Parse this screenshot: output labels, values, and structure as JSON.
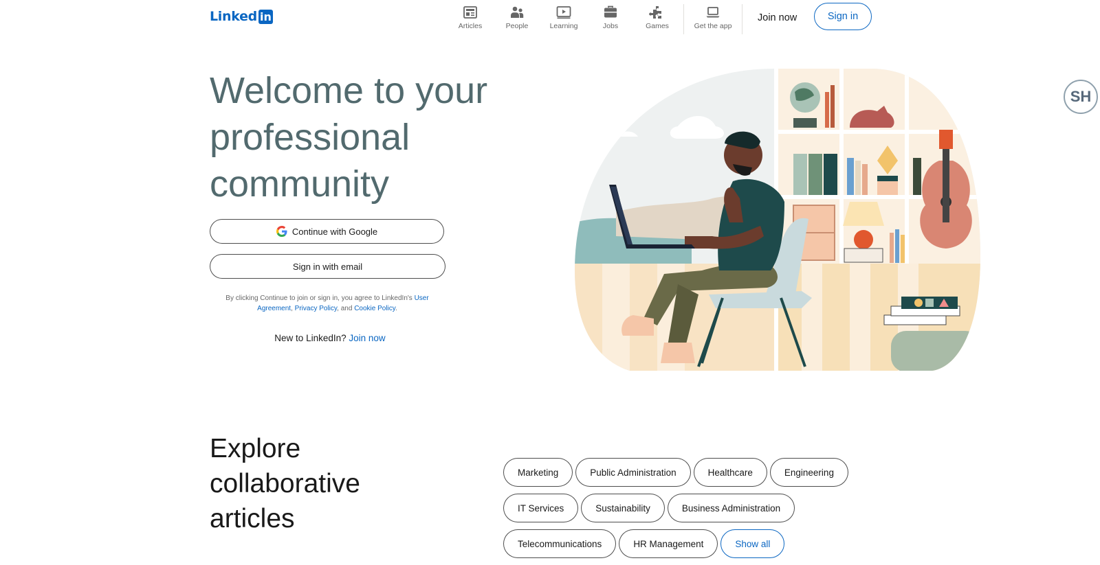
{
  "header": {
    "logo_text": "Linked",
    "logo_box": "in",
    "nav": [
      {
        "label": "Articles",
        "icon": "articles-icon"
      },
      {
        "label": "People",
        "icon": "people-icon"
      },
      {
        "label": "Learning",
        "icon": "learning-icon"
      },
      {
        "label": "Jobs",
        "icon": "jobs-icon"
      },
      {
        "label": "Games",
        "icon": "games-icon"
      },
      {
        "label": "Get the app",
        "icon": "laptop-icon"
      }
    ],
    "join_now": "Join now",
    "sign_in": "Sign in"
  },
  "hero": {
    "title": "Welcome to your professional community",
    "google_button": "Continue with Google",
    "email_button": "Sign in with email",
    "legal": {
      "prefix": "By clicking Continue to join or sign in, you agree to LinkedIn's ",
      "user_agreement": "User Agreement",
      "sep1": ", ",
      "privacy_policy": "Privacy Policy",
      "sep2": ", and ",
      "cookie_policy": "Cookie Policy",
      "suffix": "."
    },
    "new_to": "New to LinkedIn?",
    "join_now_link": "Join now"
  },
  "profile_badge": "SH",
  "explore": {
    "title": "Explore collaborative articles",
    "topic_rows": [
      [
        "Marketing",
        "Public Administration",
        "Healthcare",
        "Engineering"
      ],
      [
        "IT Services",
        "Sustainability",
        "Business Administration"
      ],
      [
        "Telecommunications",
        "HR Management"
      ]
    ],
    "show_all": "Show all"
  },
  "colors": {
    "brand": "#0a66c2",
    "hero_title": "#526a6e"
  }
}
